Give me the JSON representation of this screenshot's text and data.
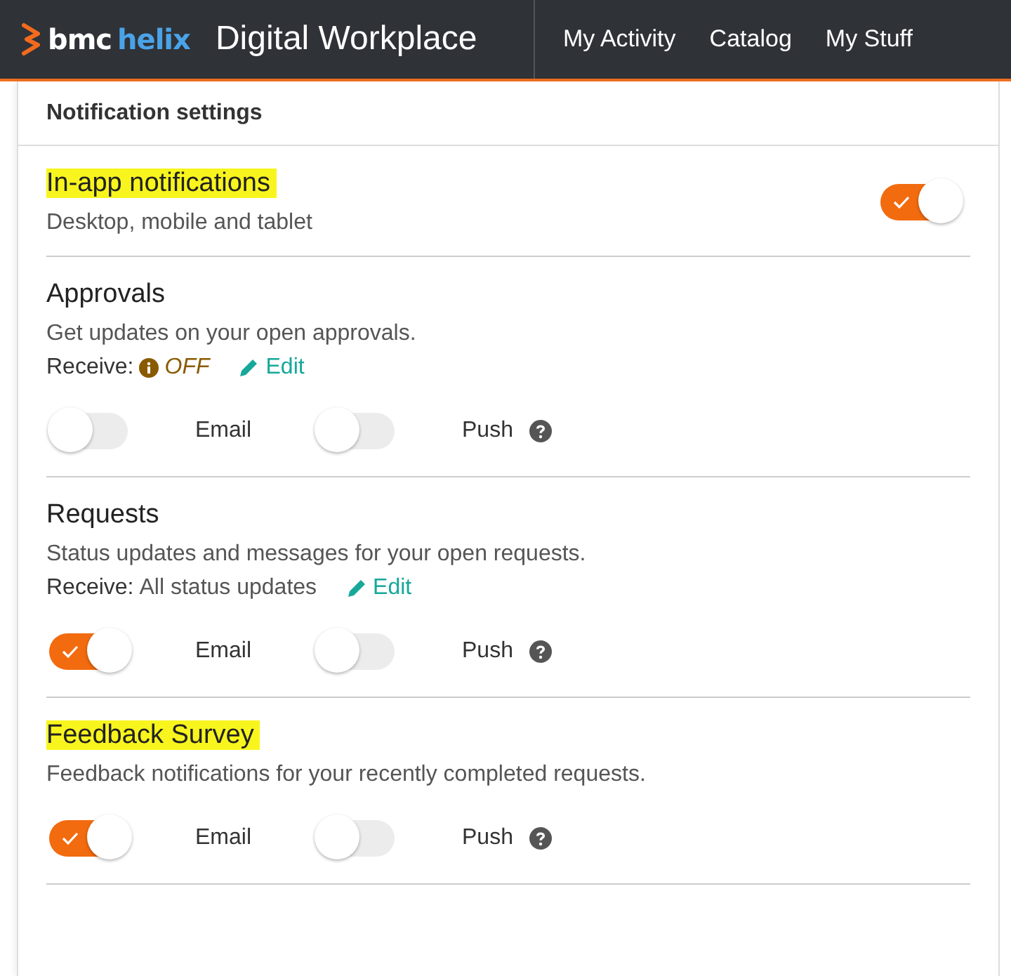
{
  "header": {
    "logo": {
      "brand": "bmc",
      "product": "helix"
    },
    "app_title": "Digital Workplace",
    "nav": [
      {
        "label": "My Activity"
      },
      {
        "label": "Catalog"
      },
      {
        "label": "My Stuff"
      }
    ]
  },
  "panel": {
    "title": "Notification settings",
    "sections": [
      {
        "kind": "master",
        "title": "In-app notifications",
        "highlighted": true,
        "description": "Desktop, mobile and tablet",
        "on": true
      },
      {
        "kind": "channels",
        "title": "Approvals",
        "highlighted": false,
        "description": "Get updates on your open approvals.",
        "receive": {
          "label": "Receive:",
          "value": "OFF",
          "kind": "warning",
          "edit": "Edit"
        },
        "channels": [
          {
            "label": "Email",
            "on": false,
            "help": false
          },
          {
            "label": "Push",
            "on": false,
            "help": true
          }
        ]
      },
      {
        "kind": "channels",
        "title": "Requests",
        "highlighted": false,
        "description": "Status updates and messages for your open requests.",
        "receive": {
          "label": "Receive:",
          "value": "All status updates",
          "kind": "plain",
          "edit": "Edit"
        },
        "channels": [
          {
            "label": "Email",
            "on": true,
            "help": false
          },
          {
            "label": "Push",
            "on": false,
            "help": true
          }
        ]
      },
      {
        "kind": "channels",
        "title": "Feedback Survey",
        "highlighted": true,
        "description": "Feedback notifications for your recently completed requests.",
        "channels": [
          {
            "label": "Email",
            "on": true,
            "help": false
          },
          {
            "label": "Push",
            "on": false,
            "help": true
          }
        ]
      }
    ]
  }
}
